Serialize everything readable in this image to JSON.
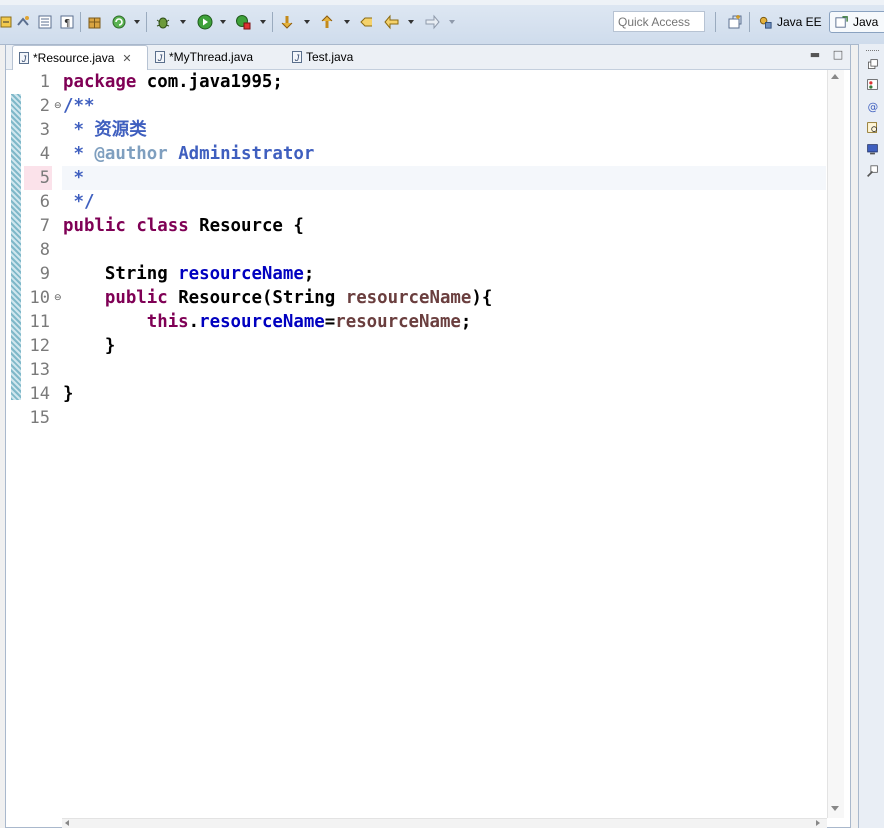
{
  "toolbar": {
    "quick_access_placeholder": "Quick Access",
    "perspectives": [
      {
        "label": "Java EE",
        "active": false
      },
      {
        "label": "Java",
        "active": true
      }
    ]
  },
  "editor": {
    "tabs": [
      {
        "label": "*Resource.java",
        "active": true,
        "closable": true
      },
      {
        "label": "*MyThread.java",
        "active": false
      },
      {
        "label": "Test.java",
        "active": false
      }
    ],
    "current_line": 5,
    "line_numbers": [
      "1",
      "2",
      "3",
      "4",
      "5",
      "6",
      "7",
      "8",
      "9",
      "10",
      "11",
      "12",
      "13",
      "14",
      "15"
    ],
    "code_lines": [
      [
        {
          "t": "package",
          "c": "kw"
        },
        {
          "t": " com.java1995;",
          "c": "plain"
        }
      ],
      [
        {
          "t": "/**",
          "c": "doc"
        }
      ],
      [
        {
          "t": " * 资源类",
          "c": "doc"
        }
      ],
      [
        {
          "t": " * ",
          "c": "doc"
        },
        {
          "t": "@author",
          "c": "tag"
        },
        {
          "t": " Administrator",
          "c": "doc"
        }
      ],
      [
        {
          "t": " *",
          "c": "doc"
        }
      ],
      [
        {
          "t": " */",
          "c": "doc"
        }
      ],
      [
        {
          "t": "public",
          "c": "kw"
        },
        {
          "t": " ",
          "c": "plain"
        },
        {
          "t": "class",
          "c": "kw"
        },
        {
          "t": " Resource {",
          "c": "plain"
        }
      ],
      [],
      [
        {
          "t": "    String ",
          "c": "plain"
        },
        {
          "t": "resourceName",
          "c": "fld"
        },
        {
          "t": ";",
          "c": "plain"
        }
      ],
      [
        {
          "t": "    ",
          "c": "plain"
        },
        {
          "t": "public",
          "c": "kw"
        },
        {
          "t": " Resource(String ",
          "c": "plain"
        },
        {
          "t": "resourceName",
          "c": "par"
        },
        {
          "t": "){",
          "c": "plain"
        }
      ],
      [
        {
          "t": "        ",
          "c": "plain"
        },
        {
          "t": "this",
          "c": "kw"
        },
        {
          "t": ".",
          "c": "plain"
        },
        {
          "t": "resourceName",
          "c": "fld"
        },
        {
          "t": "=",
          "c": "plain"
        },
        {
          "t": "resourceName",
          "c": "par"
        },
        {
          "t": ";",
          "c": "plain"
        }
      ],
      [
        {
          "t": "    }",
          "c": "plain"
        }
      ],
      [],
      [
        {
          "t": "}",
          "c": "plain"
        }
      ],
      []
    ]
  },
  "colors": {
    "keyword": "#7f0055",
    "javadoc": "#3f5fbf",
    "javadoc_tag": "#7f9fbf",
    "field": "#0000c0",
    "parameter": "#6a3e3e"
  }
}
